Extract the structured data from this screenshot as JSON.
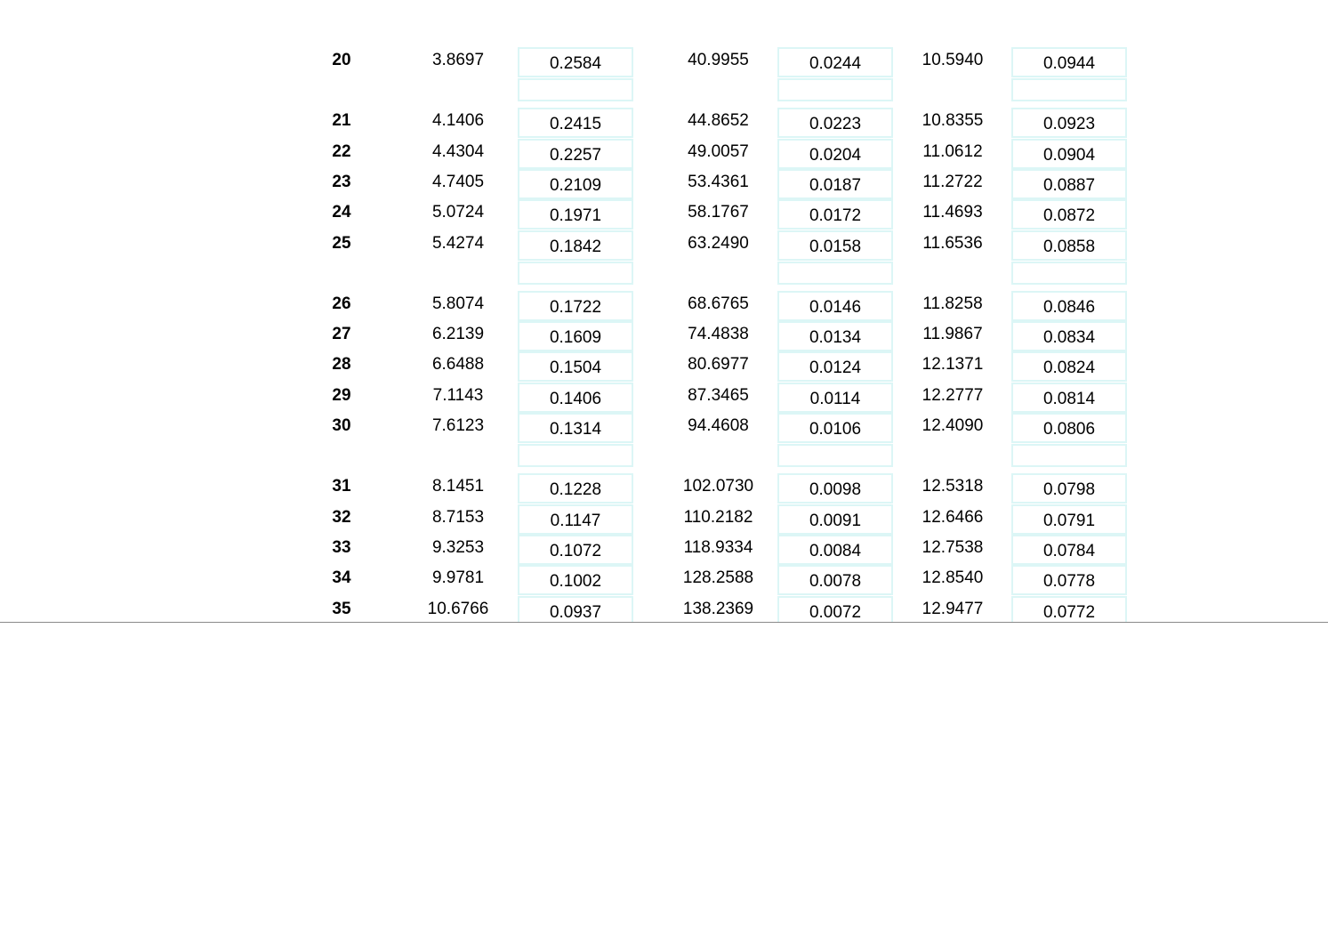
{
  "table": {
    "groups": [
      {
        "rows": [
          {
            "n": "20",
            "v1": "3.8697",
            "v2": "0.2584",
            "v3": "40.9955",
            "v4": "0.0244",
            "v5": "10.5940",
            "v6": "0.0944"
          }
        ]
      },
      {
        "rows": [
          {
            "n": "21",
            "v1": "4.1406",
            "v2": "0.2415",
            "v3": "44.8652",
            "v4": "0.0223",
            "v5": "10.8355",
            "v6": "0.0923"
          },
          {
            "n": "22",
            "v1": "4.4304",
            "v2": "0.2257",
            "v3": "49.0057",
            "v4": "0.0204",
            "v5": "11.0612",
            "v6": "0.0904"
          },
          {
            "n": "23",
            "v1": "4.7405",
            "v2": "0.2109",
            "v3": "53.4361",
            "v4": "0.0187",
            "v5": "11.2722",
            "v6": "0.0887"
          },
          {
            "n": "24",
            "v1": "5.0724",
            "v2": "0.1971",
            "v3": "58.1767",
            "v4": "0.0172",
            "v5": "11.4693",
            "v6": "0.0872"
          },
          {
            "n": "25",
            "v1": "5.4274",
            "v2": "0.1842",
            "v3": "63.2490",
            "v4": "0.0158",
            "v5": "11.6536",
            "v6": "0.0858"
          }
        ]
      },
      {
        "rows": [
          {
            "n": "26",
            "v1": "5.8074",
            "v2": "0.1722",
            "v3": "68.6765",
            "v4": "0.0146",
            "v5": "11.8258",
            "v6": "0.0846"
          },
          {
            "n": "27",
            "v1": "6.2139",
            "v2": "0.1609",
            "v3": "74.4838",
            "v4": "0.0134",
            "v5": "11.9867",
            "v6": "0.0834"
          },
          {
            "n": "28",
            "v1": "6.6488",
            "v2": "0.1504",
            "v3": "80.6977",
            "v4": "0.0124",
            "v5": "12.1371",
            "v6": "0.0824"
          },
          {
            "n": "29",
            "v1": "7.1143",
            "v2": "0.1406",
            "v3": "87.3465",
            "v4": "0.0114",
            "v5": "12.2777",
            "v6": "0.0814"
          },
          {
            "n": "30",
            "v1": "7.6123",
            "v2": "0.1314",
            "v3": "94.4608",
            "v4": "0.0106",
            "v5": "12.4090",
            "v6": "0.0806"
          }
        ]
      },
      {
        "rows": [
          {
            "n": "31",
            "v1": "8.1451",
            "v2": "0.1228",
            "v3": "102.0730",
            "v4": "0.0098",
            "v5": "12.5318",
            "v6": "0.0798"
          },
          {
            "n": "32",
            "v1": "8.7153",
            "v2": "0.1147",
            "v3": "110.2182",
            "v4": "0.0091",
            "v5": "12.6466",
            "v6": "0.0791"
          },
          {
            "n": "33",
            "v1": "9.3253",
            "v2": "0.1072",
            "v3": "118.9334",
            "v4": "0.0084",
            "v5": "12.7538",
            "v6": "0.0784"
          },
          {
            "n": "34",
            "v1": "9.9781",
            "v2": "0.1002",
            "v3": "128.2588",
            "v4": "0.0078",
            "v5": "12.8540",
            "v6": "0.0778"
          },
          {
            "n": "35",
            "v1": "10.6766",
            "v2": "0.0937",
            "v3": "138.2369",
            "v4": "0.0072",
            "v5": "12.9477",
            "v6": "0.0772"
          }
        ]
      }
    ]
  }
}
